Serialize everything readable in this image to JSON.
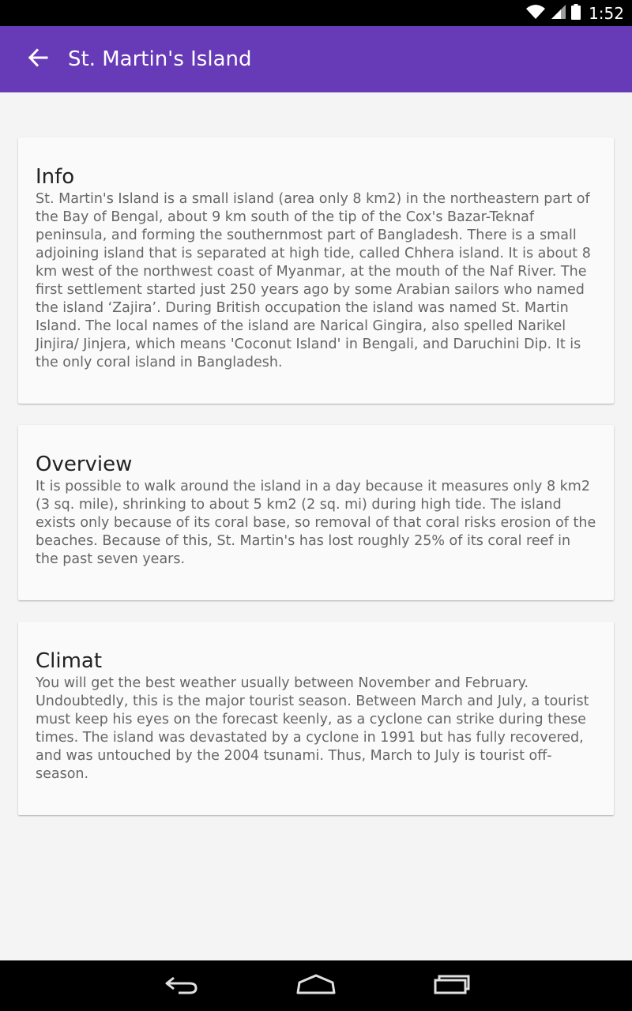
{
  "status_bar": {
    "time": "1:52",
    "icons": [
      "wifi-icon",
      "signal-icon",
      "battery-icon"
    ]
  },
  "app_bar": {
    "title": "St. Martin's Island",
    "back_icon": "arrow-back-icon",
    "color": "#673ab7"
  },
  "cards": [
    {
      "title": "Info",
      "text": "St. Martin's Island is a small island (area only 8 km2) in the northeastern part of the Bay of Bengal, about 9 km south of the tip of the Cox's Bazar-Teknaf peninsula, and forming the southernmost part of Bangladesh. There is a small adjoining island that is separated at high tide, called Chhera island. It is about 8 km west of the northwest coast of Myanmar, at the mouth of the Naf River. The first settlement started just 250 years ago by some Arabian sailors who named the island ‘Zajira’. During British occupation the island was named St. Martin Island. The local names of the island are Narical Gingira, also spelled Narikel Jinjira/ Jinjera, which means 'Coconut Island' in Bengali, and Daruchini Dip. It is the only coral island in Bangladesh."
    },
    {
      "title": "Overview",
      "text": "It is possible to walk around the island in a day because it measures only 8 km2 (3 sq. mile), shrinking to about 5 km2 (2 sq. mi) during high tide. The island exists only because of its coral base, so removal of that coral risks erosion of the beaches. Because of this, St. Martin's has lost roughly 25% of its coral reef in the past seven years."
    },
    {
      "title": "Climat",
      "text": "You will get the best weather usually between November and February. Undoubtedly, this is the major tourist season. Between March and July, a tourist must keep his eyes on the forecast keenly, as a cyclone can strike during these times. The island was devastated by a cyclone in 1991 but has fully recovered, and was untouched by the 2004 tsunami. Thus, March to July is tourist off-season."
    }
  ],
  "nav_bar": {
    "buttons": [
      "back-icon",
      "home-icon",
      "recents-icon"
    ]
  }
}
